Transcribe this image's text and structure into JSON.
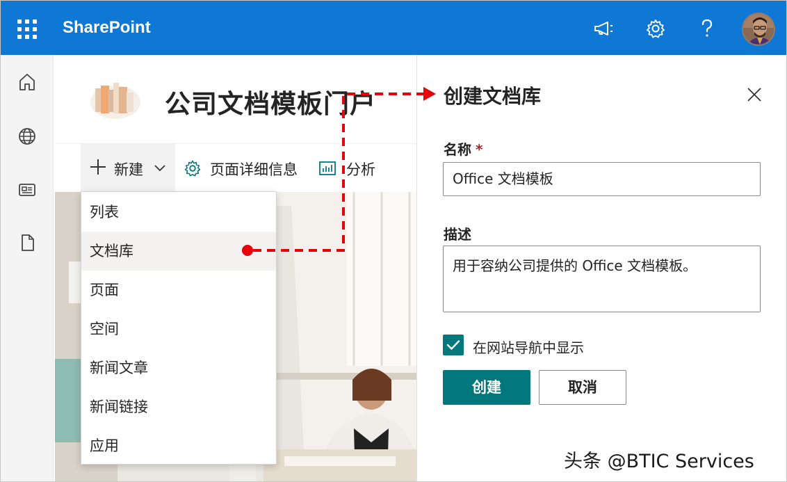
{
  "app": {
    "brand": "SharePoint"
  },
  "site": {
    "title": "公司文档模板门户"
  },
  "command_bar": {
    "new_label": "新建",
    "details_label": "页面详细信息",
    "analytics_label": "分析"
  },
  "new_menu": {
    "items": [
      {
        "label": "列表"
      },
      {
        "label": "文档库"
      },
      {
        "label": "页面"
      },
      {
        "label": "空间"
      },
      {
        "label": "新闻文章"
      },
      {
        "label": "新闻链接"
      },
      {
        "label": "应用"
      }
    ],
    "active_item": "文档库"
  },
  "panel": {
    "title": "创建文档库",
    "name_label": "名称",
    "required_marker": "*",
    "name_value": "Office 文档模板",
    "description_label": "描述",
    "description_value": "用于容纳公司提供的 Office 文档模板。",
    "show_in_nav_label": "在网站导航中显示",
    "show_in_nav_checked": true,
    "create_label": "创建",
    "cancel_label": "取消"
  },
  "icons": {
    "top_bar": [
      "app-launcher-icon",
      "megaphone-icon",
      "settings-gear-icon",
      "help-icon"
    ],
    "left_rail": [
      "home-icon",
      "globe-icon",
      "news-icon",
      "document-icon"
    ]
  },
  "colors": {
    "suite_bar": "#0f78d4",
    "theme_teal": "#03787c",
    "annotation_red": "#e8000b",
    "required_red": "#a4262c"
  },
  "watermark": "头条 @BTIC Services"
}
